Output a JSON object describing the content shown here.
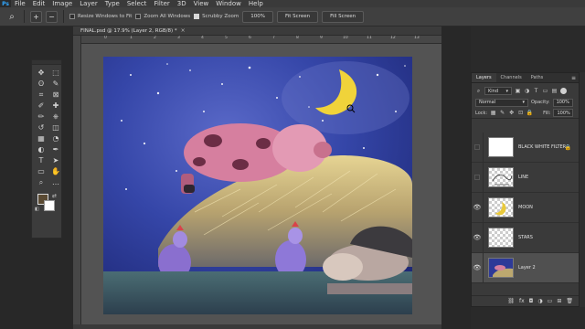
{
  "menubar": {
    "items": [
      "File",
      "Edit",
      "Image",
      "Layer",
      "Type",
      "Select",
      "Filter",
      "3D",
      "View",
      "Window",
      "Help"
    ]
  },
  "options": {
    "zoom_in_label": "+",
    "zoom_out_label": "−",
    "resize_windows": "Resize Windows to Fit",
    "zoom_all_windows": "Zoom All Windows",
    "scrubby_zoom": "Scrubby Zoom",
    "btn_100": "100%",
    "btn_fit": "Fit Screen",
    "btn_fill": "Fill Screen"
  },
  "document": {
    "tab_title": "FINAL.psd @ 17.9% (Layer 2, RGB/8) *",
    "close": "×",
    "ruler_numbers": [
      "0",
      "1",
      "2",
      "3",
      "4",
      "5",
      "6",
      "7",
      "8",
      "9",
      "10",
      "11",
      "12",
      "13"
    ]
  },
  "tools": {
    "icons": [
      "move-icon",
      "marquee-icon",
      "lasso-icon",
      "quick-select-icon",
      "crop-icon",
      "frame-icon",
      "eyedropper-icon",
      "healing-icon",
      "brush-icon",
      "stamp-icon",
      "history-brush-icon",
      "eraser-icon",
      "gradient-icon",
      "blur-icon",
      "dodge-icon",
      "pen-icon",
      "type-icon",
      "path-select-icon",
      "shape-icon",
      "hand-icon",
      "zoom-icon",
      "more-icon"
    ],
    "glyphs": [
      "✥",
      "⬚",
      "ʘ",
      "✎",
      "⌗",
      "⊠",
      "✐",
      "✚",
      "✏",
      "⎈",
      "↺",
      "◫",
      "▦",
      "◔",
      "◐",
      "✒",
      "T",
      "➤",
      "▭",
      "✋",
      "⌕",
      "…"
    ],
    "foreground_color": "#5a4a33",
    "background_color": "#ffffff"
  },
  "layers_panel": {
    "tabs": [
      "Layers",
      "Channels",
      "Paths"
    ],
    "filter_kind": "Kind",
    "blend_mode": "Normal",
    "opacity_label": "Opacity:",
    "opacity_value": "100%",
    "lock_label": "Lock:",
    "fill_label": "Fill:",
    "fill_value": "100%",
    "layers": [
      {
        "name": "BLACK WHITE FILTER",
        "visible": false,
        "locked": true,
        "selected": false
      },
      {
        "name": "LINE",
        "visible": false,
        "locked": false,
        "selected": false
      },
      {
        "name": "MOON",
        "visible": true,
        "locked": false,
        "selected": false
      },
      {
        "name": "STARS",
        "visible": true,
        "locked": false,
        "selected": false
      },
      {
        "name": "Layer 2",
        "visible": true,
        "locked": false,
        "selected": true
      }
    ],
    "footer_icons": [
      "link-icon",
      "fx-icon",
      "mask-icon",
      "adjustment-icon",
      "group-icon",
      "new-layer-icon",
      "trash-icon"
    ],
    "footer_glyphs": [
      "⛓",
      "fx",
      "◘",
      "◑",
      "▭",
      "⊞",
      "🗑"
    ]
  }
}
